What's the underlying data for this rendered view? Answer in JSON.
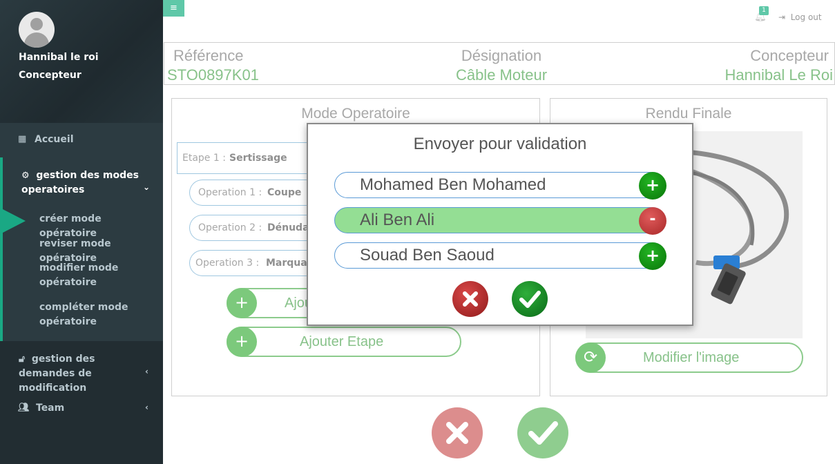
{
  "user": {
    "name": "Hannibal le roi",
    "role": "Concepteur"
  },
  "sidebar": {
    "accueil": "Accueil",
    "gestion_modes": "gestion des modes operatoires",
    "submenu": [
      "créer mode opératoire",
      "reviser mode opératoire",
      "modifier mode opératoire",
      "compléter mode opératoire"
    ],
    "gestion_demandes": "gestion des demandes de modification",
    "team": "Team"
  },
  "topbar": {
    "notification_count": "1",
    "logout": "Log out"
  },
  "info": {
    "reference_label": "Référence",
    "reference_value": "STO0897K01",
    "designation_label": "Désignation",
    "designation_value": "Câble Moteur",
    "concepteur_label": "Concepteur",
    "concepteur_value": "Hannibal Le Roi"
  },
  "mode_operatoire": {
    "title": "Mode Operatoire",
    "step": {
      "label": "Etape 1 :",
      "value": "Sertissage"
    },
    "operations": [
      {
        "label": "Operation 1 :",
        "value": "Coupe"
      },
      {
        "label": "Operation 2 :",
        "value": "Dénudage"
      },
      {
        "label": "Operation 3 :",
        "value": "Marquage"
      }
    ],
    "add_operation_label": "Ajouter Operation",
    "add_step_label": "Ajouter Etape"
  },
  "rendu": {
    "title": "Rendu Finale",
    "modify_image_label": "Modifier l'image"
  },
  "modal": {
    "title": "Envoyer pour validation",
    "people": [
      {
        "name": "Mohamed Ben Mohamed",
        "selected": false,
        "action": "+"
      },
      {
        "name": "Ali Ben Ali",
        "selected": true,
        "action": "-"
      },
      {
        "name": "Souad Ben Saoud",
        "selected": false,
        "action": "+"
      }
    ]
  },
  "colors": {
    "sidebar_bg": "#222d32",
    "accent_teal": "#1aa884",
    "label_green": "#88c28a",
    "selected_row": "#94de94",
    "cancel_red": "#a82828",
    "confirm_green": "#0a6a18"
  }
}
